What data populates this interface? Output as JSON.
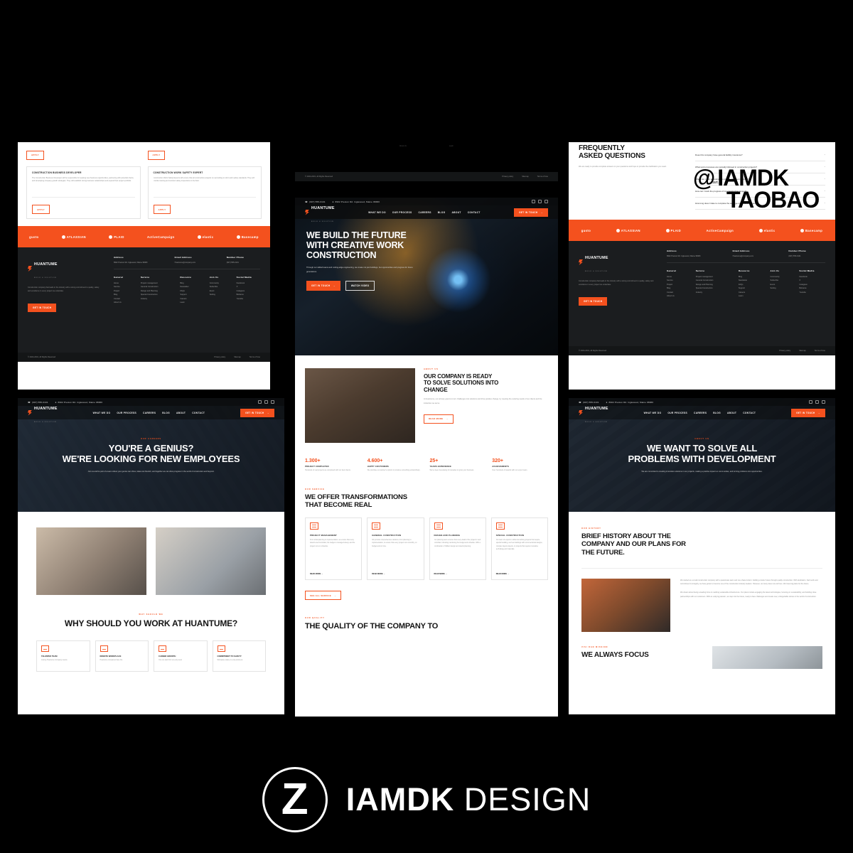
{
  "branding": {
    "mark": "Z",
    "name_bold": "IAMDK",
    "name_light": "DESIGN"
  },
  "watermark": {
    "line1": "@ IAMDK",
    "line2": "TAOBAO",
    "note": "start.io"
  },
  "site": {
    "topbar": {
      "phone": "(907) 555-0101",
      "address": "8902 Preston Rd. Inglewood, Maine 98380"
    },
    "logo": {
      "name": "HUANTUME",
      "tagline": "BUILD & SOLUTION"
    },
    "nav": [
      "WHAT WE DO",
      "OUR PROCESS",
      "CAREERS",
      "BLOG",
      "ABOUT",
      "CONTACT"
    ],
    "cta": "GET IN TOUCH",
    "social": [
      "x-icon",
      "facebook-icon",
      "instagram-icon"
    ]
  },
  "home": {
    "hero": {
      "title_lines": [
        "WE BUILD THE FUTURE",
        "WITH CREATIVE WORK",
        "CONSTRUCTION"
      ],
      "body": "Through our skilled teams and cutting-edge engineering, we create not just buildings, but opportunities and progress for future generations.",
      "primary_cta": "GET IN TOUCH",
      "secondary_cta": "WATCH VIDEO"
    },
    "about": {
      "eyebrow": "ABOUT US",
      "title_lines": [
        "OUR COMPANY IS READY",
        "TO SOLVE SOLUTIONS INTO",
        "CHANGE"
      ],
      "body": "At Huantume, our primary goal is to turn challenges into solutions and drive positive change, by meeting the evolving needs of our clients and the industries we serve.",
      "cta": "READ MORE"
    },
    "stats": [
      {
        "value": "1.300+",
        "label": "PROJECT COMPLETED",
        "desc": "Hundreds of real projects we completed with our best clients."
      },
      {
        "value": "4.600+",
        "label": "HAPPY COSTUMERS",
        "desc": "We prioritise our partner's opinion to produce something extraordinary."
      },
      {
        "value": "25+",
        "label": "YEARS EXPERIENCE",
        "desc": "We've been developing for decades to grow your business."
      },
      {
        "value": "320+",
        "label": "ACHIEVEMENTS",
        "desc": "Over hundreds of awards with our expert team."
      }
    ],
    "services": {
      "eyebrow": "OUR SERVICE",
      "title_lines": [
        "WE OFFER TRANSFORMATIONS",
        "THAT BECOME REAL"
      ],
      "cards": [
        {
          "icon": "monitor-icon",
          "title": "PROJECT MANAGEMENT",
          "desc": "From initial planning to implementation, we ensure that every detail is well controlled, the budget is managed wisely, and the project runs on schedule.",
          "cta": "READ MORE"
        },
        {
          "icon": "crane-icon",
          "title": "GENERAL CONSTRUCTION",
          "desc": "We provide comprehensive solutions, from planning to implementation, to ensure that every project runs smoothly, on budget and on time.",
          "cta": "READ MORE"
        },
        {
          "icon": "blueprint-icon",
          "title": "DESIGN AND PLANNING",
          "desc": "Our planning team ensures that every detail of the project is well controlled, including monitoring the budget and schedule. With a combination of brilliant design and careful planning.",
          "cta": "READ MORE"
        },
        {
          "icon": "structure-icon",
          "title": "SPECIAL CONSTRUCTION",
          "desc": "Our team of experts is skilled at tackling projects that require special handling, such as buildings with unconventional designs, complex layout projects, or projects that require innovative technology and materials.",
          "cta": "READ MORE"
        }
      ],
      "see_all": "SEE ALL SERVICE"
    },
    "quality": {
      "eyebrow": "OUR QUALITY",
      "title": "THE QUALITY OF THE COMPANY TO"
    }
  },
  "careers": {
    "hero": {
      "eyebrow": "OUR CAREERS",
      "title_lines": [
        "YOU'RE A GENIUS?",
        "WE'RE LOOKING FOR NEW EMPLOYEES"
      ],
      "body": "Join us and be part of a team where your genius can shine, ideas can flourish, and together we can drive progress in the world of construction and beyond."
    },
    "why": {
      "eyebrow": "WHY SHOULD WE",
      "title": "WHY SHOULD YOU WORK AT HUANTUME?",
      "cards": [
        {
          "icon": "team-icon",
          "title": "TALENTED TEAM",
          "desc": "Joining Huantume Company means"
        },
        {
          "icon": "remote-icon",
          "title": "REMOTE WORKPLACE",
          "desc": "Huantume companies have the"
        },
        {
          "icon": "growth-icon",
          "title": "CAREER GROWTH",
          "desc": "You can start from an entry-level"
        },
        {
          "icon": "safety-icon",
          "title": "COMMITMENT TO SAFETY",
          "desc": "Workplace safety is a top priority at"
        }
      ]
    },
    "jobs": [
      {
        "title": "CONSTRUCTION BUSINESS DEVELOPER",
        "desc": "The Construction Business Developer will be responsible for seeking new business opportunities, partnering with potential clients, and developing company growth strategies. They will establish strong business relationships and expand their project portfolio.",
        "cta": "APPLY"
      },
      {
        "title": "CONSTRUCTION WORK SAFETY EXPERT",
        "desc": "Construction Work Safety Experts will ensure that all construction projects run according to strict work safety standards. They will provide training and conduct safety inspections in the field.",
        "cta": "APPLY"
      }
    ],
    "apply_top": "APPLY"
  },
  "about_page": {
    "hero": {
      "eyebrow": "ABOUT US",
      "title_lines": [
        "WE WANT TO SOLVE ALL",
        "PROBLEMS WITH DEVELOPMENT"
      ],
      "body": "We are committed to creating innovative solutions in our projects, making a positive impact on communities, and turning problems into opportunities."
    },
    "history": {
      "eyebrow": "OUR HISTORY",
      "title_lines": [
        "BRIEF HISTORY ABOUT THE",
        "COMPANY AND OUR PLANS FOR",
        "THE FUTURE."
      ],
      "p1": "We started as a small construction company with a passionate team and one shared vision: building a better future through quality construction. With dedication, hard work and commitment to integrity, we have grown to become one of the construction industry leaders. However, our story does not end here. We have big plans for the future.",
      "p2": "We dream about being a leading force in realizing sustainable infrastructure. Our plans include engaging the latest technologies, focusing on sustainability, and building close partnerships with our customers. With an undying passion, we step into the future, ready to face challenges and create new, unforgettable stories in the world of construction."
    },
    "vision": {
      "eyebrow": "VISI DAN MISSION",
      "title": "WE ALWAYS FOCUS"
    }
  },
  "faq": {
    "title_lines": [
      "FREQUENTLY",
      "ASKED QUESTIONS"
    ],
    "body": "We are ready to provide complete answers to your questions and hope to provide the clarification you need.",
    "items": [
      "Does this company have general liability insurance?",
      "What work processes are typically followed in construction projects?",
      "When can I start a construction project with your company?",
      "How can I track the progress of my construction project?",
      "How long does it take to complete the average construction project?"
    ]
  },
  "partners": [
    {
      "name": "gusto",
      "icon": "gusto-logo"
    },
    {
      "name": "ATLASSIAN",
      "icon": "atlassian-logo"
    },
    {
      "name": "PLAID",
      "icon": "plaid-logo"
    },
    {
      "name": "ActiveCampaign",
      "icon": "activecampaign-logo"
    },
    {
      "name": "elastic",
      "icon": "elastic-logo"
    },
    {
      "name": "Basecamp",
      "icon": "basecamp-logo"
    }
  ],
  "footer": {
    "about": "Construction company that leads in the industry with a strong commitment to quality, safety and excellence in every project we undertake.",
    "cta": "GET IN TOUCH",
    "contact": [
      {
        "label": "Address",
        "value": "8902 Preston Rd. Inglewood, Maine 98380"
      },
      {
        "label": "Email Address",
        "value": "Huantume@company.com"
      },
      {
        "label": "Number Phone",
        "value": "(907) 555-0101"
      }
    ],
    "columns": [
      {
        "head": "General",
        "links": [
          "Home",
          "Service",
          "Project",
          "Blog",
          "Contact",
          "About Us"
        ]
      },
      {
        "head": "Service",
        "links": [
          "Project management",
          "General Construction",
          "Design and Planning",
          "Special Construction",
          "Industry"
        ]
      },
      {
        "head": "Resource",
        "links": [
          "Blog",
          "Newsletter",
          "FAQs",
          "Support",
          "Careers",
          "Learn"
        ]
      },
      {
        "head": "Join Us",
        "links": [
          "Community",
          "Subscribe",
          "Event",
          "Setting"
        ]
      },
      {
        "head": "Social Media",
        "links": [
          "Facebook",
          "X",
          "Instagram",
          "Behance",
          "Youtube"
        ]
      }
    ],
    "copyright": "© 2024-2031, All Rights Reserved",
    "legal": [
      "Privacy policy",
      "Sitemap",
      "Terms of Use"
    ]
  },
  "colors": {
    "accent": "#f4511e",
    "dark": "#1b1d1f",
    "page_bg": "#000000",
    "mock_bg": "#68768a"
  }
}
